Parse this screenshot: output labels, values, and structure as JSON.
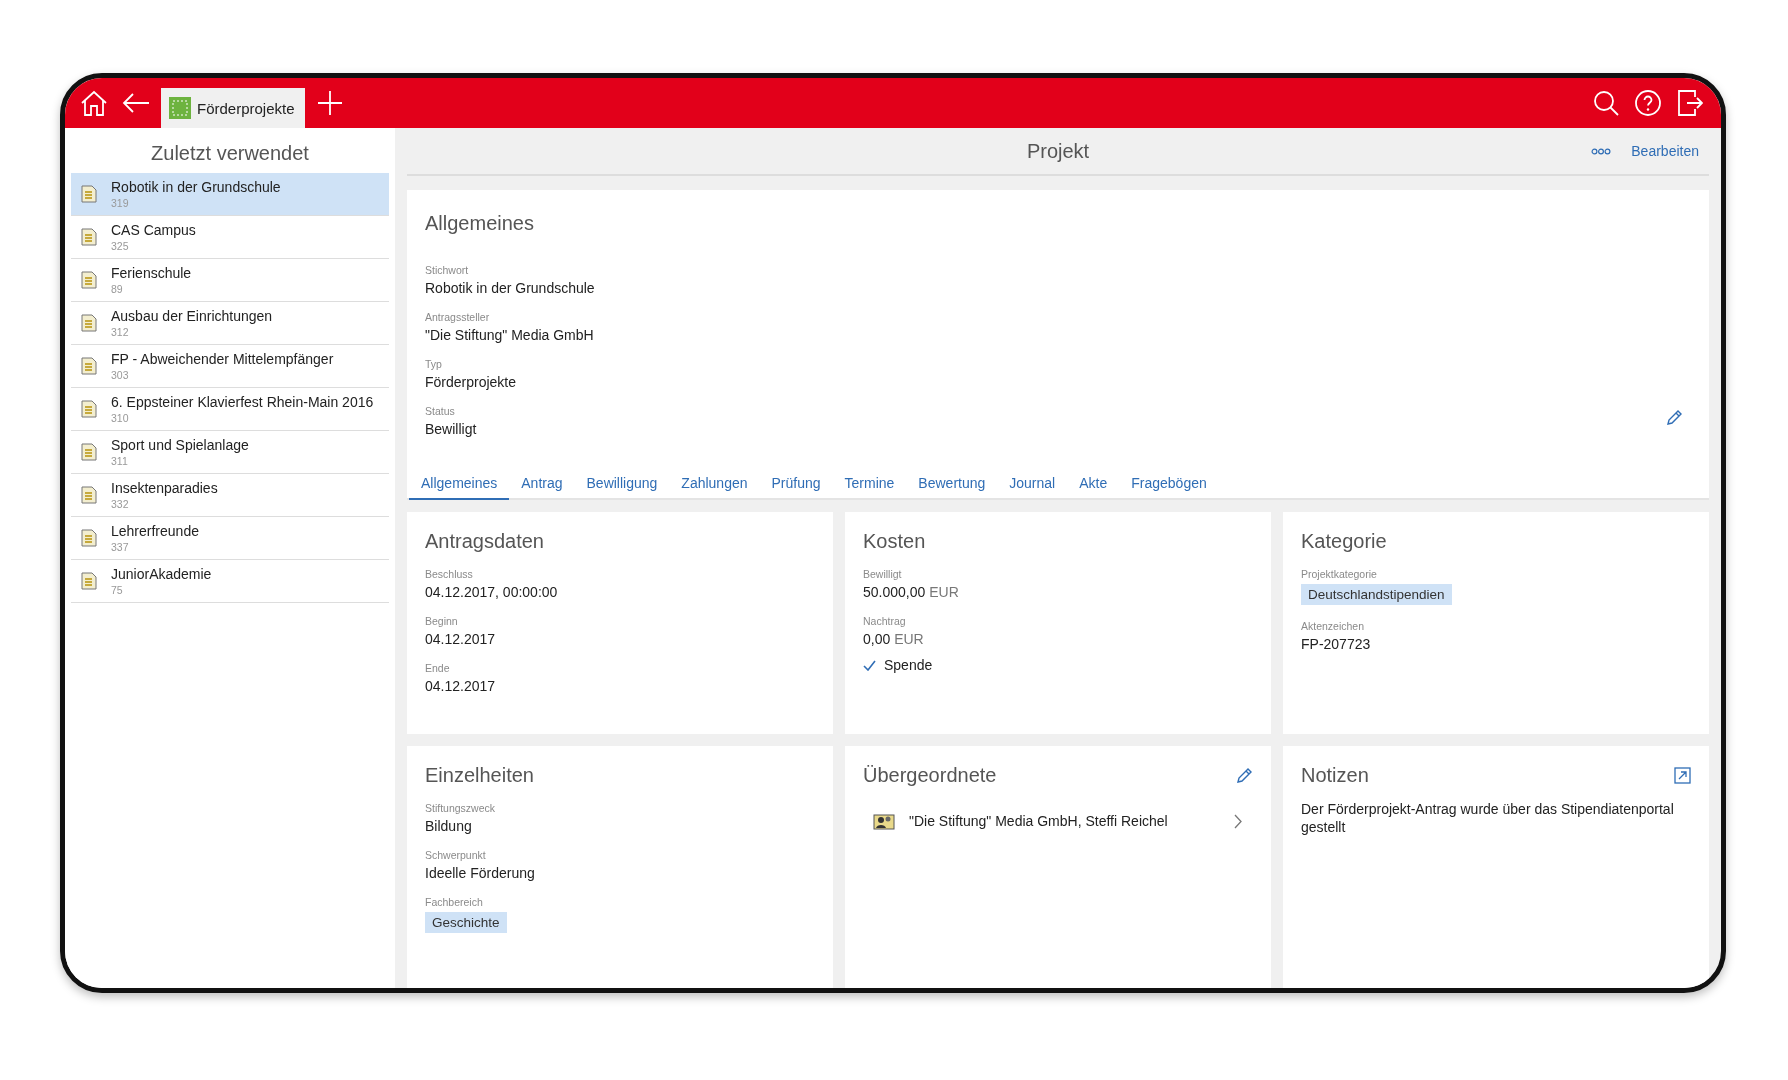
{
  "topbar": {
    "tab": {
      "label": "Förderprojekte",
      "selected": true
    }
  },
  "sidebar": {
    "title": "Zuletzt verwendet",
    "items": [
      {
        "title": "Robotik in der Grundschule",
        "number": "319",
        "selected": true
      },
      {
        "title": "CAS Campus",
        "number": "325",
        "selected": false
      },
      {
        "title": "Ferienschule",
        "number": "89",
        "selected": false
      },
      {
        "title": "Ausbau der Einrichtungen",
        "number": "312",
        "selected": false
      },
      {
        "title": "FP - Abweichender Mittelempfänger",
        "number": "303",
        "selected": false
      },
      {
        "title": "6. Eppsteiner Klavierfest Rhein-Main 2016",
        "number": "310",
        "selected": false
      },
      {
        "title": "Sport und Spielanlage",
        "number": "311",
        "selected": false
      },
      {
        "title": "Insektenparadies",
        "number": "332",
        "selected": false
      },
      {
        "title": "Lehrerfreunde",
        "number": "337",
        "selected": false
      },
      {
        "title": "JuniorAkademie",
        "number": "75",
        "selected": false
      }
    ]
  },
  "header": {
    "title": "Projekt",
    "action": "Bearbeiten"
  },
  "general": {
    "heading": "Allgemeines",
    "fields": [
      {
        "label": "Stichwort",
        "value": "Robotik in der Grundschule"
      },
      {
        "label": "Antragssteller",
        "value": "\"Die Stiftung\" Media GmbH"
      },
      {
        "label": "Typ",
        "value": "Förderprojekte"
      },
      {
        "label": "Status",
        "value": "Bewilligt"
      }
    ]
  },
  "tabs": [
    {
      "label": "Allgemeines",
      "selected": true
    },
    {
      "label": "Antrag",
      "selected": false
    },
    {
      "label": "Bewilligung",
      "selected": false
    },
    {
      "label": "Zahlungen",
      "selected": false
    },
    {
      "label": "Prüfung",
      "selected": false
    },
    {
      "label": "Termine",
      "selected": false
    },
    {
      "label": "Bewertung",
      "selected": false
    },
    {
      "label": "Journal",
      "selected": false
    },
    {
      "label": "Akte",
      "selected": false
    },
    {
      "label": "Fragebögen",
      "selected": false
    }
  ],
  "cards": [
    {
      "title": "Antragsdaten",
      "kind": "fields",
      "fields": [
        {
          "kind": "text",
          "label": "Beschluss",
          "value": "04.12.2017, 00:00:00"
        },
        {
          "kind": "text",
          "label": "Beginn",
          "value": "04.12.2017"
        },
        {
          "kind": "text",
          "label": "Ende",
          "value": "04.12.2017"
        }
      ]
    },
    {
      "title": "Kosten",
      "kind": "fields",
      "fields": [
        {
          "kind": "amount",
          "label": "Bewilligt",
          "value": "50.000,00",
          "unit": "EUR"
        },
        {
          "kind": "amount",
          "label": "Nachtrag",
          "value": "0,00",
          "unit": "EUR"
        },
        {
          "kind": "check",
          "value": "Spende",
          "checked": true
        }
      ]
    },
    {
      "title": "Kategorie",
      "kind": "fields",
      "fields": [
        {
          "kind": "tag",
          "label": "Projektkategorie",
          "value": "Deutschlandstipendien"
        },
        {
          "kind": "text",
          "label": "Aktenzeichen",
          "value": "FP-207723"
        }
      ]
    },
    {
      "title": "Einzelheiten",
      "kind": "fields",
      "fields": [
        {
          "kind": "text",
          "label": "Stiftungszweck",
          "value": "Bildung"
        },
        {
          "kind": "text",
          "label": "Schwerpunkt",
          "value": "Ideelle Förderung"
        },
        {
          "kind": "tag",
          "label": "Fachbereich",
          "value": "Geschichte"
        }
      ]
    },
    {
      "title": "Übergeordnete",
      "kind": "links",
      "editable": true,
      "links": [
        "\"Die Stiftung\" Media GmbH, Steffi Reichel"
      ]
    },
    {
      "title": "Notizen",
      "kind": "note",
      "openable": true,
      "text": "Der Förderprojekt-Antrag wurde über das Stipendiatenportal gestellt"
    }
  ]
}
